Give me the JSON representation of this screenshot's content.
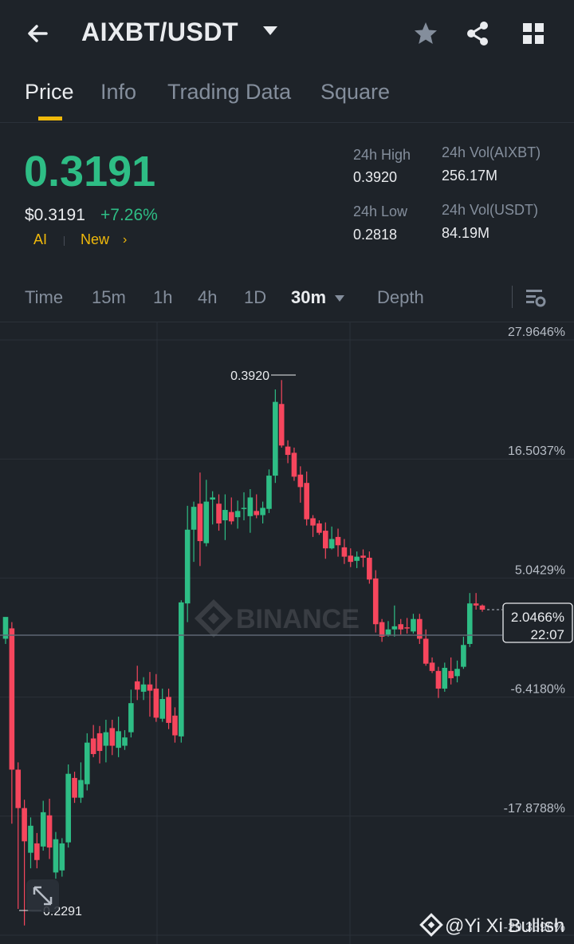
{
  "header": {
    "pair": "AIXBT/USDT"
  },
  "tabs": [
    {
      "label": "Price",
      "active": true
    },
    {
      "label": "Info",
      "active": false
    },
    {
      "label": "Trading Data",
      "active": false
    },
    {
      "label": "Square",
      "active": false
    }
  ],
  "ticker": {
    "last_price": "0.3191",
    "usd_price": "$0.3191",
    "change": "+7.26%",
    "tags": [
      "AI",
      "New"
    ],
    "stats": {
      "high_label": "24h High",
      "high_value": "0.3920",
      "low_label": "24h Low",
      "low_value": "0.2818",
      "vol_base_label": "24h Vol(AIXBT)",
      "vol_base_value": "256.17M",
      "vol_quote_label": "24h Vol(USDT)",
      "vol_quote_value": "84.19M"
    }
  },
  "intervals": [
    {
      "label": "Time",
      "active": false
    },
    {
      "label": "15m",
      "active": false
    },
    {
      "label": "1h",
      "active": false
    },
    {
      "label": "4h",
      "active": false
    },
    {
      "label": "1D",
      "active": false
    },
    {
      "label": "30m",
      "active": true
    },
    {
      "label": "Depth",
      "active": false
    }
  ],
  "colors": {
    "up": "#2ebd85",
    "down": "#f6465d",
    "accent": "#f0b90b",
    "bg": "#1e2329",
    "grid": "#2b3139"
  },
  "chart_data": {
    "type": "candlestick",
    "y_axis_labels": [
      "27.9646%",
      "16.5037%",
      "5.0429%",
      "-6.4180%",
      "-17.8788%",
      "-29.3396%"
    ],
    "ylim": [
      -29.3396,
      27.9646
    ],
    "current": {
      "value": "2.0466%",
      "time": "22:07"
    },
    "high_marker": "0.3920",
    "low_marker": "0.2291",
    "watermark": "BINANCE",
    "candles": [
      [
        -0.8,
        1.3,
        -1.3,
        0.2
      ],
      [
        0.2,
        -13.4,
        0.8,
        -18.6
      ],
      [
        -13.4,
        -17.1,
        -12.7,
        -26.8
      ],
      [
        -17.1,
        -20.3,
        -16.3,
        -28.4
      ],
      [
        -21.4,
        -18.8,
        -18.0,
        -22.9
      ],
      [
        -20.5,
        -22.1,
        -19.5,
        -22.9
      ],
      [
        -20.8,
        -17.5,
        -16.4,
        -21.2
      ],
      [
        -17.8,
        -20.9,
        -16.2,
        -22.0
      ],
      [
        -23.3,
        -20.1,
        -19.4,
        -23.9
      ],
      [
        -23.1,
        -20.5,
        -20.0,
        -23.7
      ],
      [
        -20.4,
        -13.8,
        -12.9,
        -20.9
      ],
      [
        -14.2,
        -16.1,
        -13.6,
        -16.6
      ],
      [
        -16.1,
        -14.4,
        -12.7,
        -16.6
      ],
      [
        -14.8,
        -10.8,
        -9.9,
        -15.4
      ],
      [
        -10.4,
        -11.9,
        -9.1,
        -12.2
      ],
      [
        -9.9,
        -11.6,
        -9.2,
        -12.8
      ],
      [
        -11.1,
        -9.8,
        -8.6,
        -12.7
      ],
      [
        -9.4,
        -11.1,
        -8.6,
        -12.0
      ],
      [
        -11.3,
        -9.7,
        -8.3,
        -12.2
      ],
      [
        -11.1,
        -10.3,
        -9.6,
        -11.5
      ],
      [
        -9.8,
        -7.0,
        -5.7,
        -10.3
      ],
      [
        -4.9,
        -5.7,
        -3.4,
        -6.7
      ],
      [
        -5.9,
        -5.2,
        -4.5,
        -6.7
      ],
      [
        -5.2,
        -5.8,
        -4.0,
        -8.3
      ],
      [
        -5.6,
        -8.4,
        -4.2,
        -8.8
      ],
      [
        -8.5,
        -6.6,
        -5.6,
        -8.8
      ],
      [
        -6.4,
        -8.9,
        -5.6,
        -9.5
      ],
      [
        -8.2,
        -10.1,
        -7.4,
        -10.8
      ],
      [
        -10.2,
        2.7,
        2.9,
        -10.8
      ],
      [
        2.6,
        9.7,
        12.0,
        0.8
      ],
      [
        9.7,
        11.9,
        12.4,
        6.6
      ],
      [
        12.2,
        8.6,
        15.2,
        6.2
      ],
      [
        8.4,
        12.4,
        14.5,
        8.1
      ],
      [
        12.6,
        12.8,
        13.4,
        10.2
      ],
      [
        12.2,
        10.3,
        13.1,
        9.6
      ],
      [
        10.6,
        11.6,
        13.1,
        8.7
      ],
      [
        11.4,
        10.5,
        12.8,
        10.2
      ],
      [
        10.9,
        11.5,
        12.5,
        9.8
      ],
      [
        11.8,
        11.8,
        13.3,
        10.6
      ],
      [
        11.0,
        12.8,
        13.6,
        9.4
      ],
      [
        11.5,
        11.1,
        13.1,
        10.8
      ],
      [
        11.1,
        11.8,
        12.4,
        10.3
      ],
      [
        11.7,
        14.9,
        15.5,
        11.3
      ],
      [
        14.9,
        22.0,
        23.2,
        14.2
      ],
      [
        21.8,
        17.8,
        24.1,
        17.6
      ],
      [
        17.7,
        16.9,
        18.3,
        16.1
      ],
      [
        17.1,
        14.8,
        17.6,
        14.4
      ],
      [
        15.0,
        13.8,
        15.8,
        12.3
      ],
      [
        14.2,
        10.7,
        15.3,
        10.1
      ],
      [
        10.8,
        10.1,
        11.1,
        9.0
      ],
      [
        10.3,
        9.4,
        10.6,
        9.2
      ],
      [
        9.6,
        7.9,
        10.4,
        6.9
      ],
      [
        7.9,
        8.8,
        10.0,
        7.8
      ],
      [
        9.0,
        8.2,
        9.8,
        7.1
      ],
      [
        8.0,
        7.1,
        8.8,
        6.4
      ],
      [
        7.2,
        6.6,
        7.9,
        6.1
      ],
      [
        6.7,
        7.1,
        7.6,
        6.0
      ],
      [
        7.2,
        7.0,
        7.8,
        6.1
      ],
      [
        7.0,
        4.9,
        7.6,
        4.5
      ],
      [
        5.0,
        0.6,
        5.8,
        -0.2
      ],
      [
        0.8,
        -0.6,
        1.1,
        -1.1
      ],
      [
        -0.4,
        0.1,
        0.9,
        -0.6
      ],
      [
        0.1,
        0.4,
        2.4,
        -0.6
      ],
      [
        0.6,
        0.1,
        1.1,
        -0.4
      ],
      [
        0.3,
        0.2,
        1.2,
        -0.3
      ],
      [
        -0.1,
        1.1,
        1.6,
        -0.3
      ],
      [
        1.1,
        -0.8,
        1.6,
        -1.3
      ],
      [
        -0.8,
        -3.2,
        0.1,
        -3.4
      ],
      [
        -3.1,
        -3.9,
        -2.6,
        -4.1
      ],
      [
        -3.9,
        -5.6,
        -3.5,
        -6.5
      ],
      [
        -5.6,
        -3.6,
        -3.1,
        -5.9
      ],
      [
        -3.9,
        -4.6,
        -2.6,
        -5.2
      ],
      [
        -4.4,
        -3.7,
        -2.9,
        -5.0
      ],
      [
        -3.5,
        -1.4,
        -0.6,
        -3.7
      ],
      [
        -1.3,
        2.6,
        3.6,
        -1.6
      ],
      [
        2.6,
        2.4,
        3.6,
        2.0
      ],
      [
        2.4,
        2.0,
        2.5,
        1.8
      ]
    ]
  },
  "credit": {
    "text": "@Yi Xi Bullish"
  }
}
